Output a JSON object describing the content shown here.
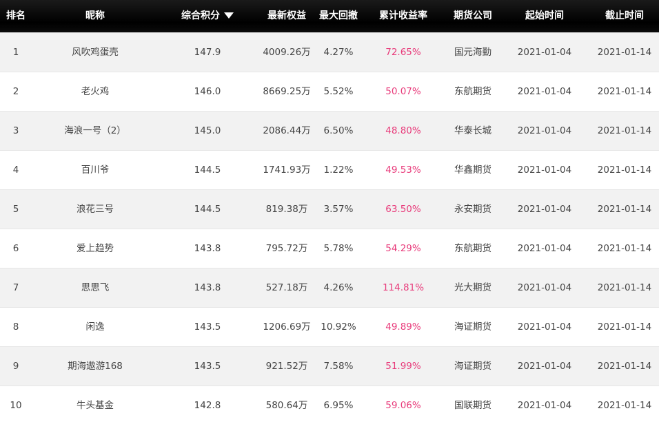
{
  "header": {
    "rank": "排名",
    "nickname": "昵称",
    "score": "综合积分",
    "equity": "最新权益",
    "max_drawdown": "最大回撤",
    "cum_return": "累计收益率",
    "broker": "期货公司",
    "start": "起始时间",
    "end": "截止时间",
    "sort_icon": "sort-desc-triangle"
  },
  "colors": {
    "header_bg": "#000000",
    "row_alt": "#f2f2f2",
    "return_color": "#e83a7a"
  },
  "rows": [
    {
      "rank": "1",
      "nickname": "风吹鸡蛋壳",
      "score": "147.9",
      "equity": "4009.26万",
      "max_drawdown": "4.27%",
      "cum_return": "72.65%",
      "broker": "国元海勤",
      "start": "2021-01-04",
      "end": "2021-01-14"
    },
    {
      "rank": "2",
      "nickname": "老火鸡",
      "score": "146.0",
      "equity": "8669.25万",
      "max_drawdown": "5.52%",
      "cum_return": "50.07%",
      "broker": "东航期货",
      "start": "2021-01-04",
      "end": "2021-01-14"
    },
    {
      "rank": "3",
      "nickname": "海浪一号（2）",
      "score": "145.0",
      "equity": "2086.44万",
      "max_drawdown": "6.50%",
      "cum_return": "48.80%",
      "broker": "华泰长城",
      "start": "2021-01-04",
      "end": "2021-01-14"
    },
    {
      "rank": "4",
      "nickname": "百川爷",
      "score": "144.5",
      "equity": "1741.93万",
      "max_drawdown": "1.22%",
      "cum_return": "49.53%",
      "broker": "华鑫期货",
      "start": "2021-01-04",
      "end": "2021-01-14"
    },
    {
      "rank": "5",
      "nickname": "浪花三号",
      "score": "144.5",
      "equity": "819.38万",
      "max_drawdown": "3.57%",
      "cum_return": "63.50%",
      "broker": "永安期货",
      "start": "2021-01-04",
      "end": "2021-01-14"
    },
    {
      "rank": "6",
      "nickname": "爱上趋势",
      "score": "143.8",
      "equity": "795.72万",
      "max_drawdown": "5.78%",
      "cum_return": "54.29%",
      "broker": "东航期货",
      "start": "2021-01-04",
      "end": "2021-01-14"
    },
    {
      "rank": "7",
      "nickname": "思思飞",
      "score": "143.8",
      "equity": "527.18万",
      "max_drawdown": "4.26%",
      "cum_return": "114.81%",
      "broker": "光大期货",
      "start": "2021-01-04",
      "end": "2021-01-14"
    },
    {
      "rank": "8",
      "nickname": "闲逸",
      "score": "143.5",
      "equity": "1206.69万",
      "max_drawdown": "10.92%",
      "cum_return": "49.89%",
      "broker": "海证期货",
      "start": "2021-01-04",
      "end": "2021-01-14"
    },
    {
      "rank": "9",
      "nickname": "期海遨游168",
      "score": "143.5",
      "equity": "921.52万",
      "max_drawdown": "7.58%",
      "cum_return": "51.99%",
      "broker": "海证期货",
      "start": "2021-01-04",
      "end": "2021-01-14"
    },
    {
      "rank": "10",
      "nickname": "牛头基金",
      "score": "142.8",
      "equity": "580.64万",
      "max_drawdown": "6.95%",
      "cum_return": "59.06%",
      "broker": "国联期货",
      "start": "2021-01-04",
      "end": "2021-01-14"
    }
  ]
}
